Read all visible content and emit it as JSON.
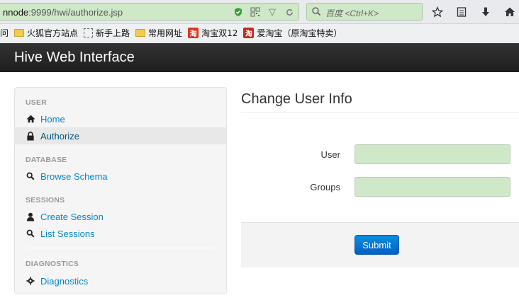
{
  "browser": {
    "url_host": "nnode",
    "url_rest": ":9999/hwi/authorize.jsp",
    "search_placeholder": "百度 <Ctrl+K>",
    "icons": [
      "shield-icon",
      "qr-icon",
      "dropdown-icon",
      "reload-icon",
      "star-icon",
      "bookmarks-list-icon",
      "download-icon",
      "home-icon"
    ]
  },
  "bookmarks": {
    "partial": "问",
    "items": [
      {
        "label": "火狐官方站点",
        "icon": "folder-icon"
      },
      {
        "label": "新手上路",
        "icon": "page-icon"
      },
      {
        "label": "常用网址",
        "icon": "folder-icon"
      },
      {
        "label": "淘宝双12",
        "icon": "taobao-icon"
      },
      {
        "label": "爱淘宝（原淘宝特卖）",
        "icon": "taobao-icon"
      }
    ],
    "taobao_glyph": "淘"
  },
  "navbar": {
    "brand": "Hive Web Interface"
  },
  "sidebar": {
    "sections": [
      {
        "header": "User",
        "items": [
          {
            "label": "Home",
            "icon": "home-icon"
          },
          {
            "label": "Authorize",
            "icon": "lock-icon",
            "active": true
          }
        ]
      },
      {
        "header": "Database",
        "items": [
          {
            "label": "Browse Schema",
            "icon": "search-icon"
          }
        ]
      },
      {
        "header": "Sessions",
        "items": [
          {
            "label": "Create Session",
            "icon": "user-icon"
          },
          {
            "label": "List Sessions",
            "icon": "search-icon"
          }
        ]
      },
      {
        "header": "Diagnostics",
        "items": [
          {
            "label": "Diagnostics",
            "icon": "gear-icon"
          }
        ]
      }
    ]
  },
  "main": {
    "title": "Change User Info",
    "fields": [
      {
        "label": "User",
        "value": ""
      },
      {
        "label": "Groups",
        "value": ""
      }
    ],
    "submit_label": "Submit"
  },
  "colors": {
    "link": "#0088cc",
    "navbar": "#222222",
    "input_autofill": "#cfe8c8",
    "primary_button": "#0074cc"
  }
}
